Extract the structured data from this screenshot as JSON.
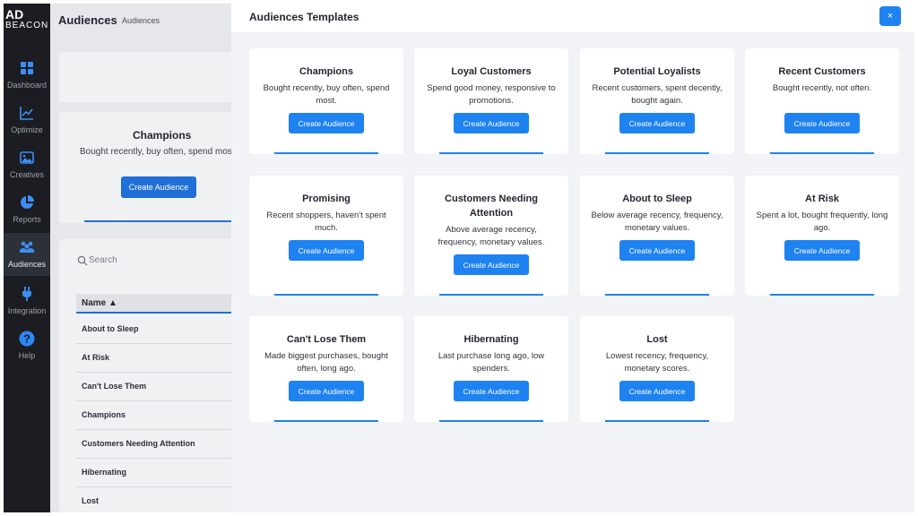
{
  "sidebar": {
    "logo_line1": "AD",
    "logo_line2": "BEACON",
    "items": [
      {
        "label": "Dashboard",
        "icon": "dashboard-icon"
      },
      {
        "label": "Optimize",
        "icon": "chart-line-icon"
      },
      {
        "label": "Creatives",
        "icon": "image-icon"
      },
      {
        "label": "Reports",
        "icon": "pie-chart-icon"
      },
      {
        "label": "Audiences",
        "icon": "users-icon",
        "active": true
      },
      {
        "label": "Integration",
        "icon": "plug-icon"
      },
      {
        "label": "Help",
        "icon": "help-icon"
      }
    ]
  },
  "background": {
    "title": "Audiences",
    "breadcrumb": "Audiences",
    "card": {
      "title": "Champions",
      "desc": "Bought recently, buy often, spend most.",
      "button": "Create Audience"
    },
    "search_placeholder": "Search",
    "table_header": "Name ▲",
    "rows": [
      "About to Sleep",
      "At Risk",
      "Can't Lose Them",
      "Champions",
      "Customers Needing Attention",
      "Hibernating",
      "Lost"
    ]
  },
  "modal": {
    "title": "Audiences Templates",
    "close_label": "×",
    "button_label": "Create Audience",
    "templates": [
      {
        "title": "Champions",
        "desc": "Bought recently, buy often, spend most."
      },
      {
        "title": "Loyal Customers",
        "desc": "Spend good money, responsive to promotions."
      },
      {
        "title": "Potential Loyalists",
        "desc": "Recent customers, spent decently, bought again."
      },
      {
        "title": "Recent Customers",
        "desc": "Bought recently, not often."
      },
      {
        "title": "Promising",
        "desc": "Recent shoppers, haven't spent much."
      },
      {
        "title": "Customers Needing Attention",
        "desc": "Above average recency, frequency, monetary values."
      },
      {
        "title": "About to Sleep",
        "desc": "Below average recency, frequency, monetary values."
      },
      {
        "title": "At Risk",
        "desc": "Spent a lot, bought frequently, long ago."
      },
      {
        "title": "Can't Lose Them",
        "desc": "Made biggest purchases, bought often, long ago."
      },
      {
        "title": "Hibernating",
        "desc": "Last purchase long ago, low spenders."
      },
      {
        "title": "Lost",
        "desc": "Lowest recency, frequency, monetary scores."
      }
    ]
  },
  "colors": {
    "accent": "#1e82f0",
    "sidebar_bg": "#1b1d22",
    "panel_bg": "#f2f3f6"
  }
}
